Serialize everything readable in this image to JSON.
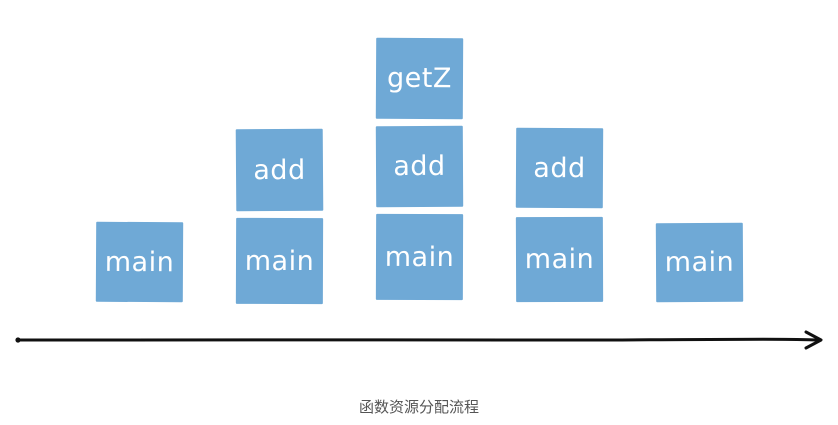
{
  "diagram": {
    "columns": [
      {
        "blocks": [
          "main"
        ]
      },
      {
        "blocks": [
          "add",
          "main"
        ]
      },
      {
        "blocks": [
          "getZ",
          "add",
          "main"
        ]
      },
      {
        "blocks": [
          "add",
          "main"
        ]
      },
      {
        "blocks": [
          "main"
        ]
      }
    ],
    "block_color": "#6fa9d6",
    "text_color": "#ffffff",
    "arrow_color": "#111111"
  },
  "caption": "函数资源分配流程"
}
